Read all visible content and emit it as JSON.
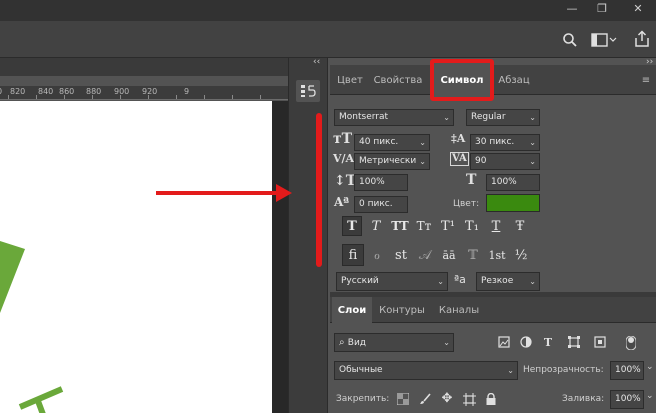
{
  "window": {
    "buttons": [
      "—",
      "❐",
      "✕"
    ]
  },
  "options_bar": {
    "icons": [
      "search-icon",
      "workspace-icon",
      "share-icon"
    ]
  },
  "ruler": {
    "ticks": [
      "0",
      "820",
      "840",
      "860",
      "880",
      "900",
      "920",
      "9"
    ]
  },
  "panel": {
    "collapse_left": "‹‹",
    "collapse_right": "››",
    "tabs": [
      {
        "label": "Цвет"
      },
      {
        "label": "Свойства"
      },
      {
        "label": "Символ"
      },
      {
        "label": "Абзац"
      }
    ],
    "menu": "≡"
  },
  "character": {
    "font_family": "Montserrat",
    "font_style": "Regular",
    "font_size": "40 пикс.",
    "leading": "30 пикс.",
    "kerning": "Метрически",
    "tracking": "90",
    "vertical_scale": "100%",
    "horizontal_scale": "100%",
    "baseline_shift": "0 пикс.",
    "color_label": "Цвет:",
    "color_value": "#3a8a0f",
    "style_buttons": [
      "T",
      "T",
      "TT",
      "Tт",
      "T¹",
      "T₁",
      "T",
      "Ŧ"
    ],
    "opentype_buttons": [
      "fi",
      "ℴ",
      "st",
      "𝒜",
      "āā",
      "𝕋",
      "1st",
      "½"
    ],
    "language": "Русский",
    "aa_icon": "ªa",
    "antialias": "Резкое"
  },
  "layers": {
    "tabs": [
      {
        "label": "Слои"
      },
      {
        "label": "Контуры"
      },
      {
        "label": "Каналы"
      }
    ],
    "filter": "Вид",
    "blend_mode": "Обычные",
    "opacity_label": "Непрозрачность:",
    "opacity_value": "100%",
    "lock_label": "Закрепить:",
    "fill_label": "Заливка:",
    "fill_value": "100%"
  },
  "colors": {
    "annotation_red": "#e31b1b",
    "canvas_green": "#6aa83a"
  }
}
